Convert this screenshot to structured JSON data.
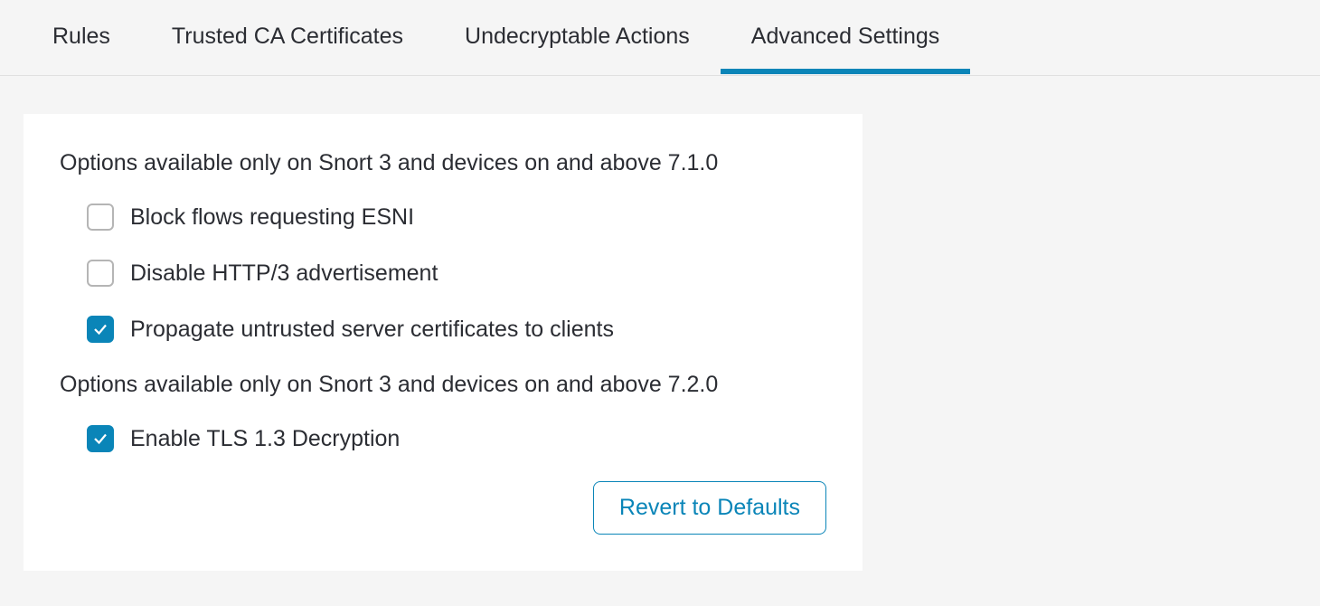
{
  "tabs": {
    "items": [
      {
        "label": "Rules",
        "active": false
      },
      {
        "label": "Trusted CA Certificates",
        "active": false
      },
      {
        "label": "Undecryptable Actions",
        "active": false
      },
      {
        "label": "Advanced Settings",
        "active": true
      }
    ]
  },
  "panel": {
    "sections": [
      {
        "heading": "Options available only on Snort 3 and devices on and above 7.1.0",
        "options": [
          {
            "label": "Block flows requesting ESNI",
            "checked": false
          },
          {
            "label": "Disable HTTP/3 advertisement",
            "checked": false
          },
          {
            "label": "Propagate untrusted server certificates to clients",
            "checked": true
          }
        ]
      },
      {
        "heading": "Options available only on Snort 3 and devices on and above 7.2.0",
        "options": [
          {
            "label": "Enable TLS 1.3 Decryption",
            "checked": true
          }
        ]
      }
    ],
    "revert_label": "Revert to Defaults"
  }
}
